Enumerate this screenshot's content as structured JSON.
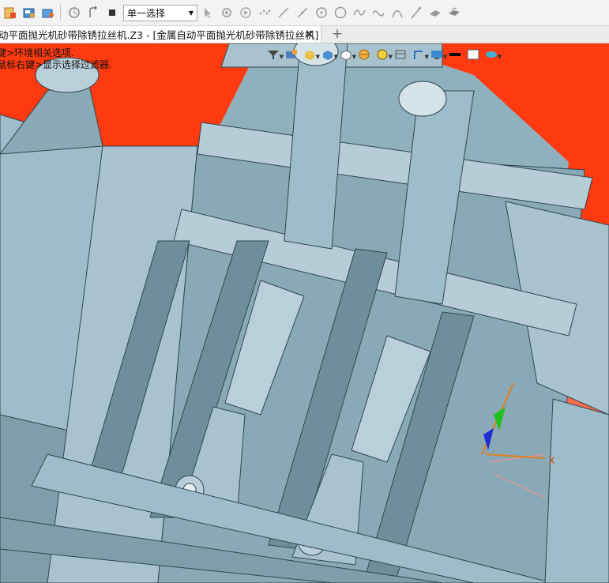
{
  "toolbar": {
    "selection_mode": "单一选择",
    "icons": [
      "new-file-icon",
      "open-file-icon",
      "save-icon",
      "rotate-view-icon",
      "undo-arrow-icon",
      "stop-icon",
      "cursor-icon",
      "pick-point-icon",
      "play-icon",
      "points-icon",
      "line-icon",
      "segment-icon",
      "circle-center-icon",
      "circle-icon",
      "spline-icon",
      "curve-icon",
      "arc-icon",
      "tangent-line-icon",
      "mesh-icon",
      "surface-icon"
    ]
  },
  "tab": {
    "title": "动平面抛光机砂带除锈拉丝机.Z3 - [金属自动平面抛光机砂带除锈拉丝机]",
    "new_tab_symbol": "+"
  },
  "hint": {
    "line1": "键>环境相关选项.",
    "line2": "鼠标右键>显示选择过滤器."
  },
  "view_toolbar": {
    "icons": [
      "filter-icon",
      "dimension-icon",
      "shaded-box-icon",
      "wireframe-box-icon",
      "white-cube-icon",
      "section-icon",
      "render-icon",
      "layout-icon",
      "view-orient-icon",
      "display-icon",
      "color-black-icon",
      "color-white-icon",
      "visibility-icon"
    ]
  },
  "triad": {
    "x_label": "X"
  },
  "colors": {
    "background_red": "#ff3a10",
    "frame": "#a9c3ce",
    "frame_dark": "#5f7c88",
    "toolbar_bg": "#f3f3f3"
  }
}
